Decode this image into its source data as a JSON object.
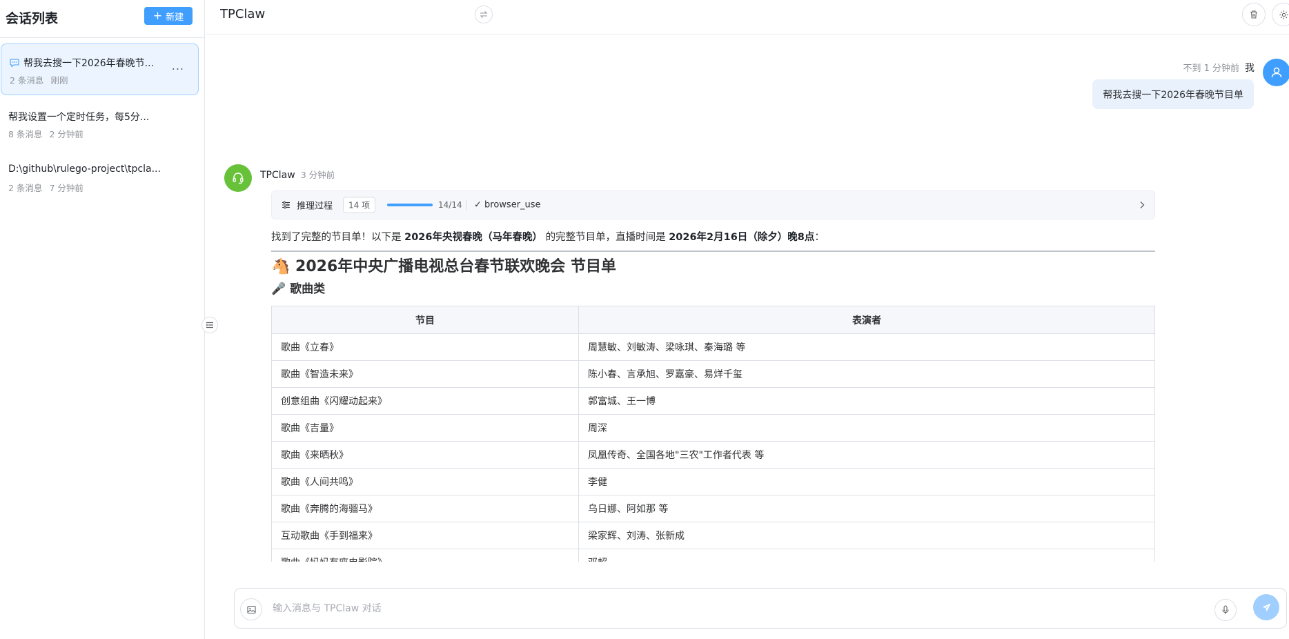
{
  "sidebar": {
    "title": "会话列表",
    "new_button": "新建",
    "conversations": [
      {
        "title": "帮我去搜一下2026年春晚节...",
        "count": "2 条消息",
        "time": "刚刚"
      },
      {
        "title": "帮我设置一个定时任务，每5分...",
        "count": "8 条消息",
        "time": "2 分钟前"
      },
      {
        "title": "D:\\github\\rulego-project\\tpcla...",
        "count": "2 条消息",
        "time": "7 分钟前"
      }
    ],
    "more": "..."
  },
  "header": {
    "title": "TPClaw"
  },
  "user_message": {
    "time": "不到 1 分钟前",
    "name": "我",
    "text": "帮我去搜一下2026年春晚节目单"
  },
  "bot_message": {
    "name": "TPClaw",
    "time": "3 分钟前",
    "reasoning": {
      "label": "推理过程",
      "count": "14 项",
      "progress": 1.0,
      "fraction": "14/14",
      "tool": "✓ browser_use"
    },
    "intro": {
      "p1": "找到了完整的节目单！以下是 ",
      "b1": "2026年央视春晚（马年春晚）",
      "p2": " 的完整节目单，直播时间是 ",
      "b2": "2026年2月16日（除夕）晚8点",
      "p3": "："
    },
    "heading": "🐴 2026年中央广播电视总台春节联欢晚会 节目单",
    "subheading": "🎤 歌曲类",
    "table": {
      "headers": [
        "节目",
        "表演者"
      ],
      "rows": [
        [
          "歌曲《立春》",
          "周慧敏、刘敏涛、梁咏琪、秦海璐 等"
        ],
        [
          "歌曲《智造未来》",
          "陈小春、言承旭、罗嘉豪、易烊千玺"
        ],
        [
          "创意组曲《闪耀动起来》",
          "郭富城、王一博"
        ],
        [
          "歌曲《吉量》",
          "周深"
        ],
        [
          "歌曲《来晒秋》",
          "凤凰传奇、全国各地\"三农\"工作者代表 等"
        ],
        [
          "歌曲《人间共鸣》",
          "李健"
        ],
        [
          "歌曲《奔腾的海骝马》",
          "乌日娜、阿如那 等"
        ],
        [
          "互动歌曲《手到福来》",
          "梁家辉、刘涛、张新成"
        ],
        [
          "歌曲《妈妈有座电影院》",
          "邓超"
        ]
      ]
    }
  },
  "input": {
    "placeholder": "输入消息与 TPClaw 对话"
  },
  "colors": {
    "accent": "#409eff",
    "bot_avatar": "#67c23a",
    "send_disabled": "#a0cfff"
  }
}
